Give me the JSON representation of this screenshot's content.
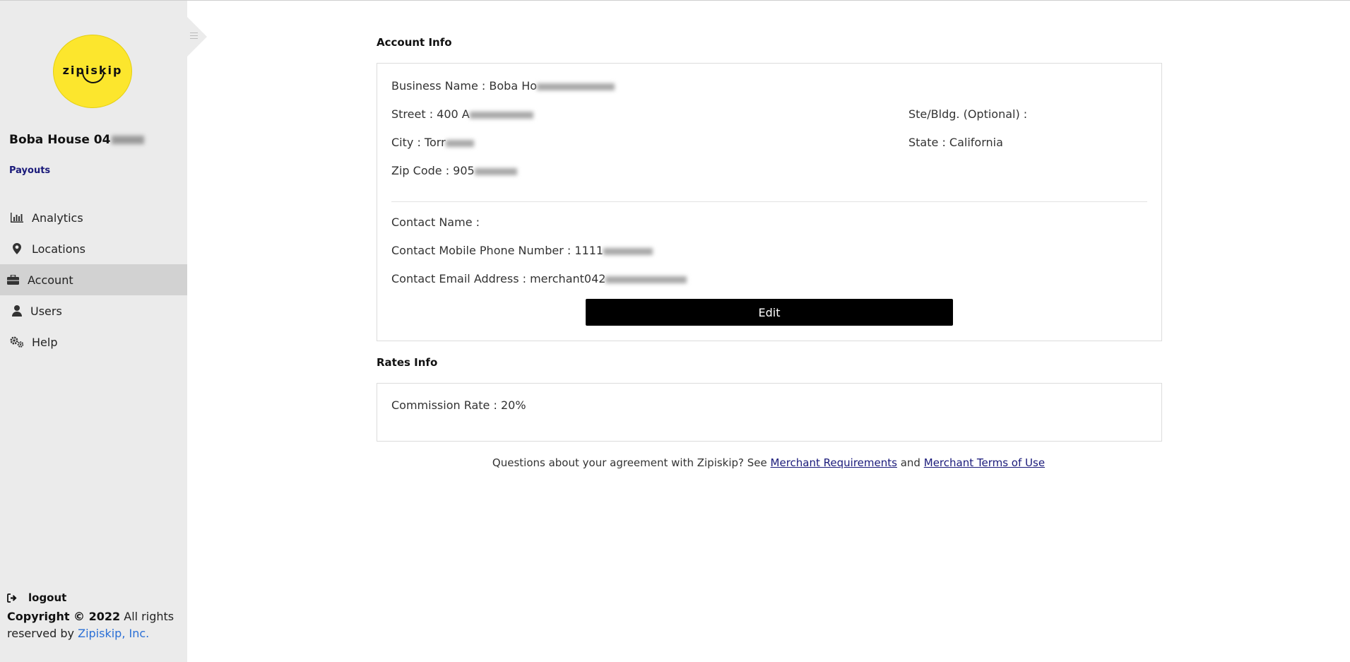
{
  "sidebar": {
    "logo_text": "zipiskip",
    "business_name": "Boba House 04",
    "payouts_label": "Payouts",
    "nav": [
      {
        "label": "Analytics",
        "icon": "bar-chart-icon"
      },
      {
        "label": "Locations",
        "icon": "map-pin-icon"
      },
      {
        "label": "Account",
        "icon": "briefcase-icon",
        "active": true
      },
      {
        "label": "Users",
        "icon": "user-icon"
      },
      {
        "label": "Help",
        "icon": "gears-icon"
      }
    ],
    "logout_label": "logout",
    "copyright_bold": "Copyright © 2022",
    "copyright_text": "All rights reserved by",
    "company_link": "Zipiskip, Inc."
  },
  "account_info": {
    "title": "Account Info",
    "business_name": "Business Name : Boba Ho",
    "street": "Street : 400 A",
    "ste_bldg": "Ste/Bldg. (Optional) :",
    "city": "City : Torr",
    "state": "State : California",
    "zip": "Zip Code : 905",
    "contact_name": "Contact Name :",
    "contact_phone": "Contact Mobile Phone Number : 1111",
    "contact_email": "Contact Email Address : merchant042",
    "edit_label": "Edit"
  },
  "rates_info": {
    "title": "Rates Info",
    "commission": "Commission Rate : 20%"
  },
  "footer": {
    "text_before": "Questions about your agreement with Zipiskip? See",
    "link1": "Merchant Requirements",
    "text_mid": "and",
    "link2": "Merchant Terms of Use"
  },
  "colors": {
    "sidebar_bg": "#ebebeb",
    "active_item_bg": "#d2d2d2",
    "logo_yellow": "#fce62d",
    "link_blue": "#1a1a7a",
    "company_link_blue": "#2a6fd6",
    "button_black": "#000000"
  }
}
